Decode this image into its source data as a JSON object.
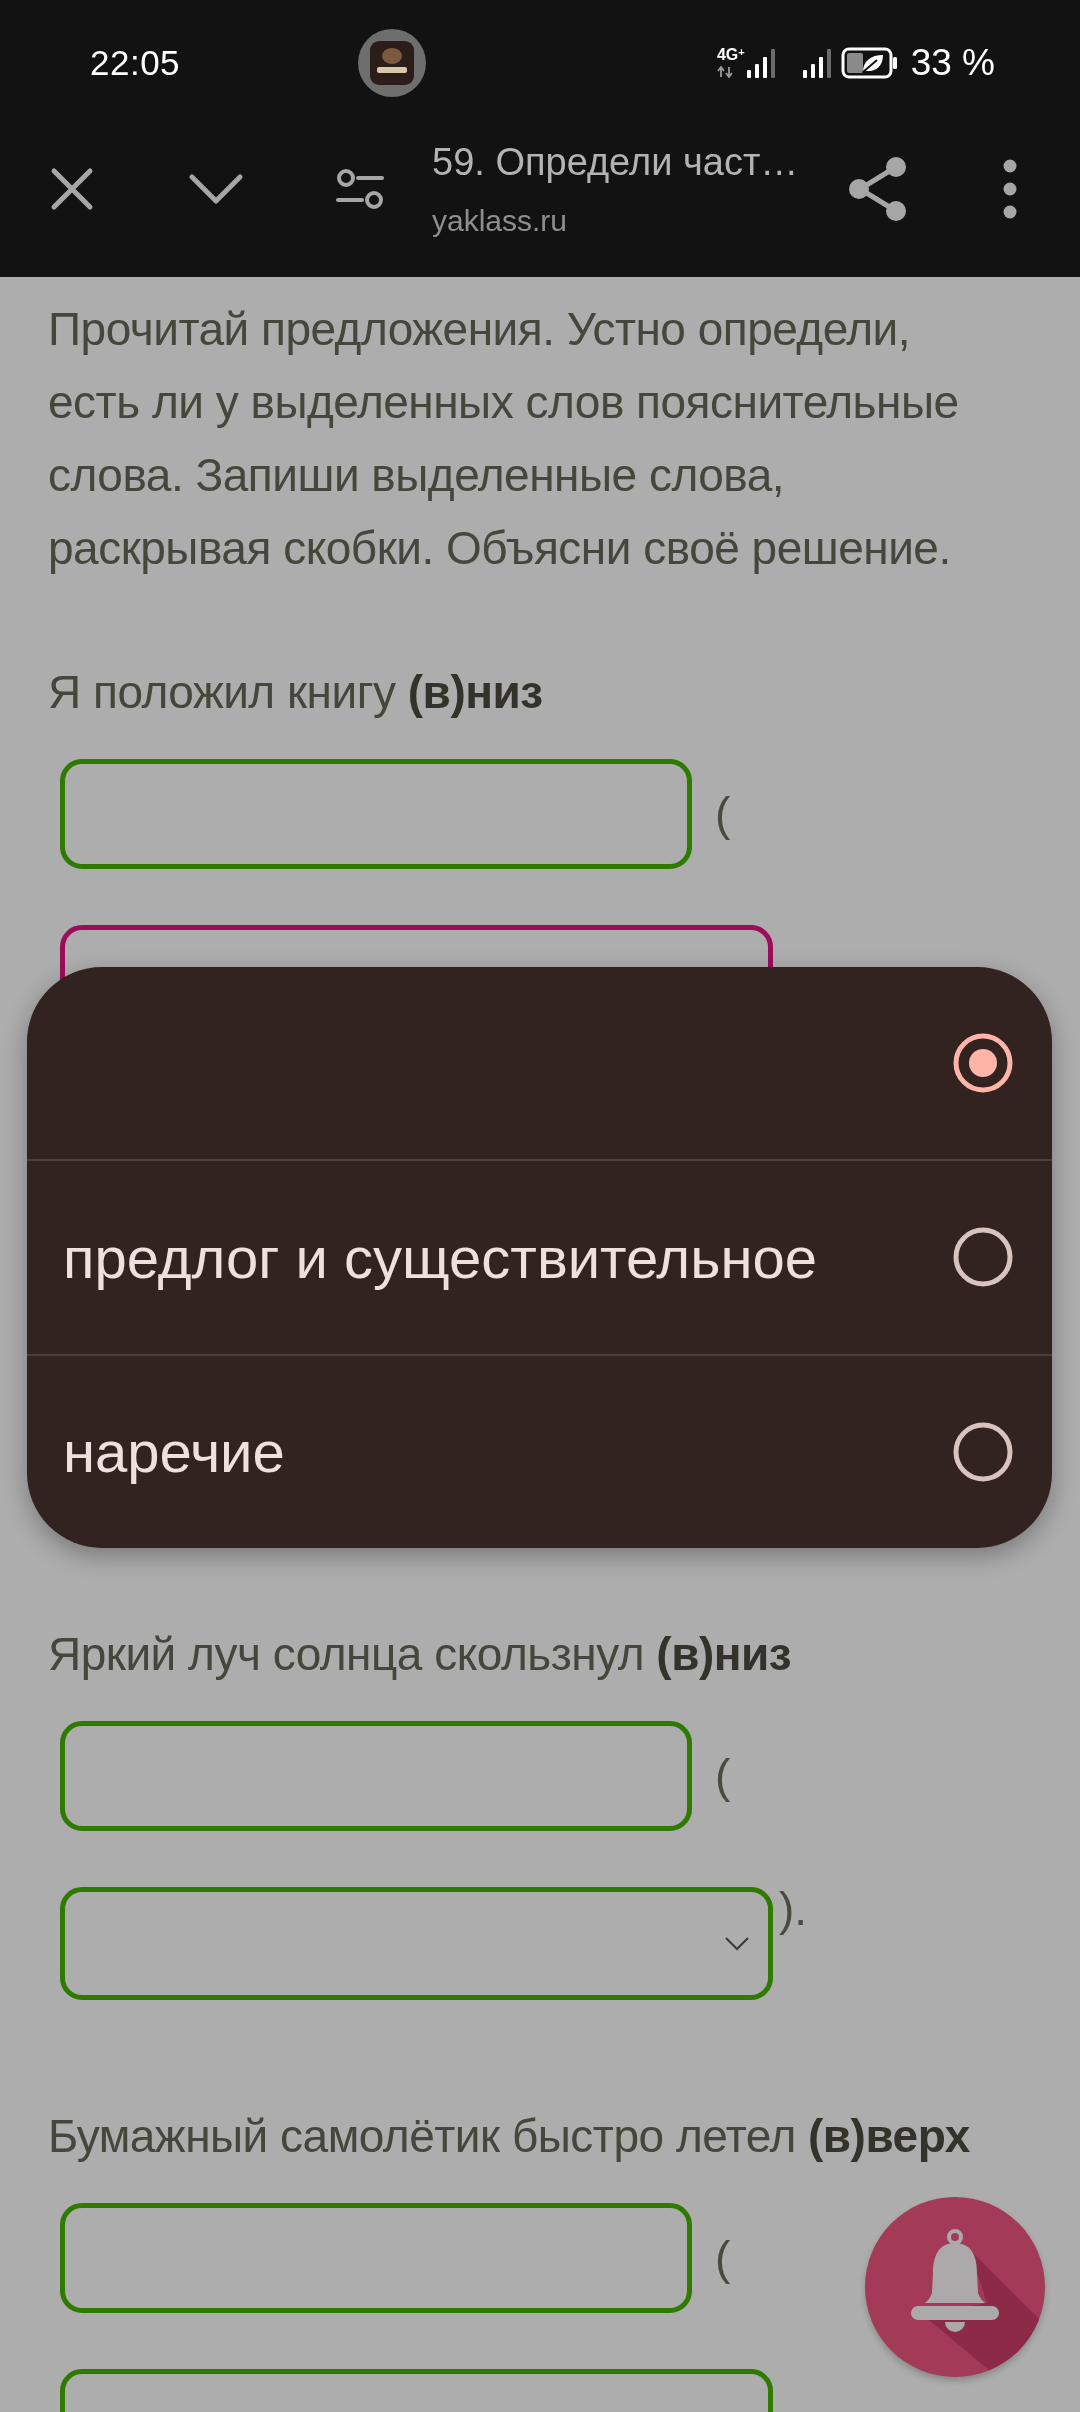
{
  "status_bar": {
    "time": "22:05",
    "network_type": "4G$^{+}$",
    "battery": "33 %"
  },
  "browser_bar": {
    "title": "59. Определи част…",
    "url": "yaklass.ru"
  },
  "instructions": "Прочитай предложения. Устно определи, есть ли у выделенных слов пояснительные слова. Запиши выделенные слова, раскрывая скобки. Объясни своё решение.",
  "questions": [
    {
      "sentence": "Я положил книгу **(в)низ**",
      "open_bracket": "(",
      "select": {
        "focused": true
      }
    },
    {
      "sentence": "Яркий луч солнца скользнул **(в)низ**",
      "open_bracket": "(",
      "select": {
        "focused": false
      },
      "close_bracket": ")."
    },
    {
      "sentence": "Бумажный самолётик быстро летел **(в)верх**",
      "open_bracket": "(",
      "select": {
        "focused": false
      }
    }
  ],
  "dropdown_menu": {
    "options": [
      {
        "selected": true
      },
      {
        "label": "предлог и существительное",
        "selected": false
      },
      {
        "label": "наречие",
        "selected": false
      }
    ]
  }
}
